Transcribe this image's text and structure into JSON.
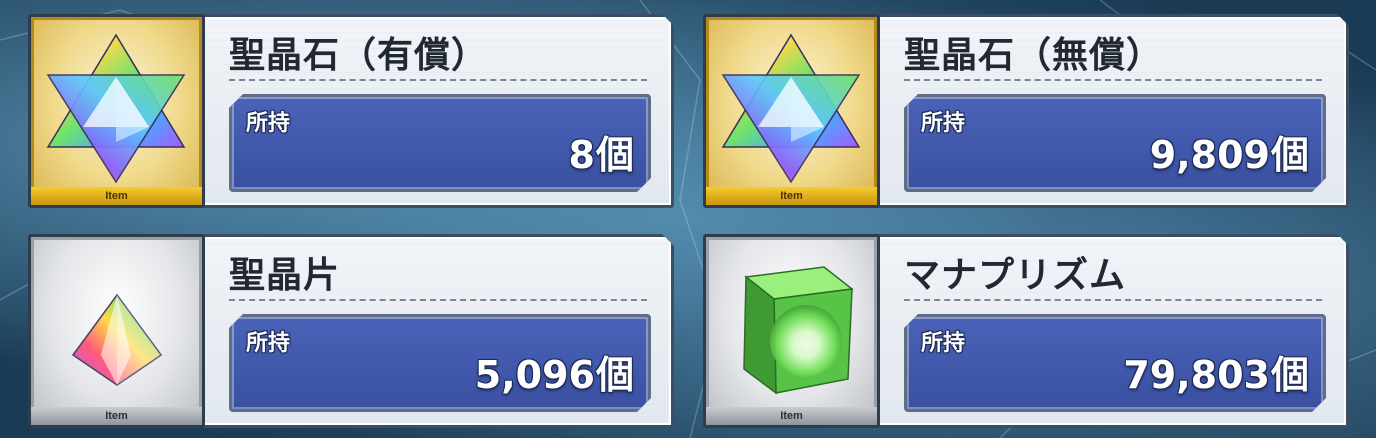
{
  "items": [
    {
      "title": "聖晶石（有償）",
      "label": "所持",
      "amount": "8",
      "unit": "個",
      "tag": "Item",
      "icon": "saint-quartz-icon"
    },
    {
      "title": "聖晶石（無償）",
      "label": "所持",
      "amount": "9,809",
      "unit": "個",
      "tag": "Item",
      "icon": "saint-quartz-icon"
    },
    {
      "title": "聖晶片",
      "label": "所持",
      "amount": "5,096",
      "unit": "個",
      "tag": "Item",
      "icon": "quartz-fragment-icon"
    },
    {
      "title": "マナプリズム",
      "label": "所持",
      "amount": "79,803",
      "unit": "個",
      "tag": "Item",
      "icon": "mana-prism-icon"
    }
  ],
  "colors": {
    "value_box": "#3f55a8",
    "gold_frame": "#d9b24a",
    "silver_frame": "#b9bdc3",
    "prism_green": "#6fe05a"
  }
}
